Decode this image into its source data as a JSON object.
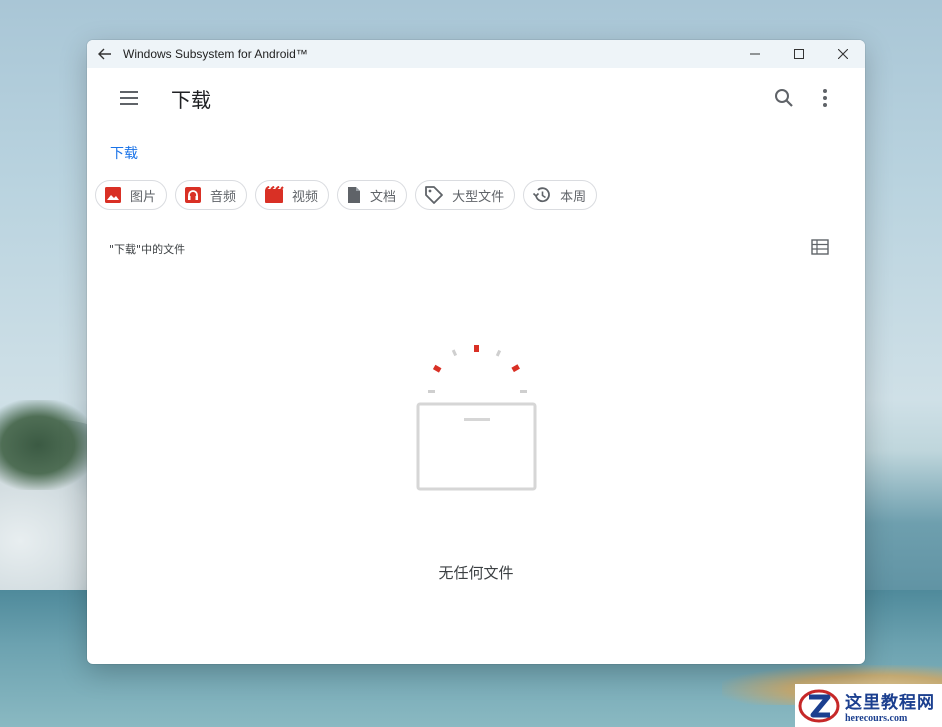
{
  "window": {
    "title": "Windows Subsystem for Android™"
  },
  "appbar": {
    "title": "下载"
  },
  "breadcrumb": "下载",
  "chips": [
    {
      "label": "图片",
      "icon": "image-icon",
      "color": "#d93025"
    },
    {
      "label": "音频",
      "icon": "headphones-icon",
      "color": "#d93025"
    },
    {
      "label": "视频",
      "icon": "movie-icon",
      "color": "#d93025"
    },
    {
      "label": "文档",
      "icon": "document-icon",
      "color": "#5f6368"
    },
    {
      "label": "大型文件",
      "icon": "tag-icon",
      "color": "#5f6368"
    },
    {
      "label": "本周",
      "icon": "history-icon",
      "color": "#5f6368"
    }
  ],
  "section": {
    "title": "\"下载\"中的文件"
  },
  "empty_state": {
    "message": "无任何文件"
  },
  "watermark": {
    "cn": "这里教程网",
    "en": "herecours.com"
  },
  "colors": {
    "accent": "#1a73e8",
    "icon_red": "#d93025",
    "icon_gray": "#5f6368"
  }
}
